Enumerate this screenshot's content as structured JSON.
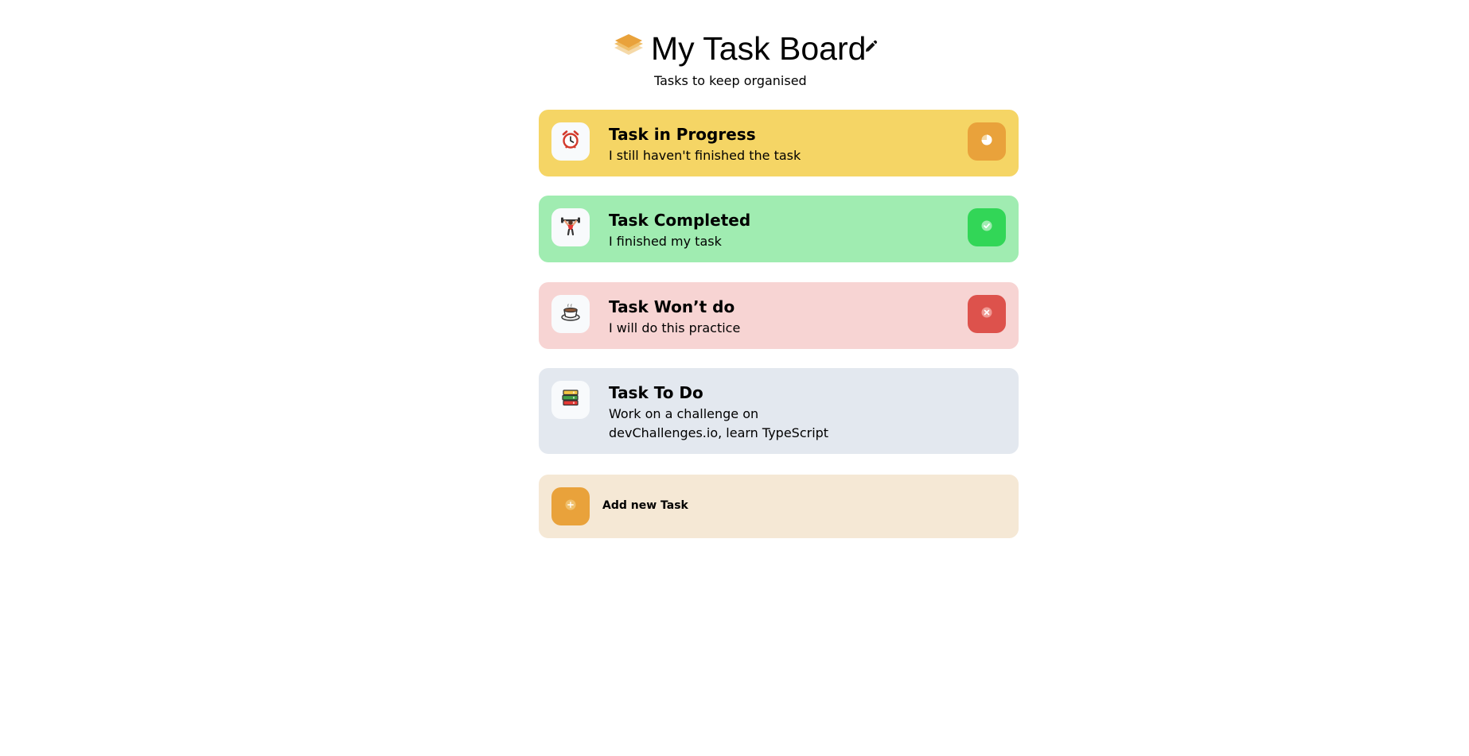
{
  "header": {
    "title": "My Task Board",
    "subtitle": "Tasks to keep organised",
    "logo_icon": "stacked-layers-icon",
    "edit_icon": "pencil-icon"
  },
  "tasks": [
    {
      "title": "Task in Progress",
      "description": "I still haven't finished the task",
      "emoji_icon": "alarm-clock-icon",
      "status": "in-progress",
      "status_icon": "time-progress-icon",
      "card_color": "#f5d565",
      "status_color": "#e9a23b"
    },
    {
      "title": "Task Completed",
      "description": "I finished my task",
      "emoji_icon": "weight-lifter-icon",
      "status": "completed",
      "status_icon": "check-icon",
      "card_color": "#a0ecb1",
      "status_color": "#32d657"
    },
    {
      "title": "Task Won’t do",
      "description": "I will do this practice",
      "emoji_icon": "coffee-cup-icon",
      "status": "wont-do",
      "status_icon": "close-icon",
      "card_color": "#f7d4d3",
      "status_color": "#dd524c"
    },
    {
      "title": "Task To Do",
      "description": "Work on a challenge on devChallenges.io, learn TypeScript",
      "emoji_icon": "books-icon",
      "status": "to-do",
      "status_icon": "",
      "card_color": "#e3e8ef",
      "status_color": ""
    }
  ],
  "add_task": {
    "label": "Add new Task",
    "icon": "plus-icon",
    "color": "#e9a23b",
    "background": "#f5e8d5"
  }
}
